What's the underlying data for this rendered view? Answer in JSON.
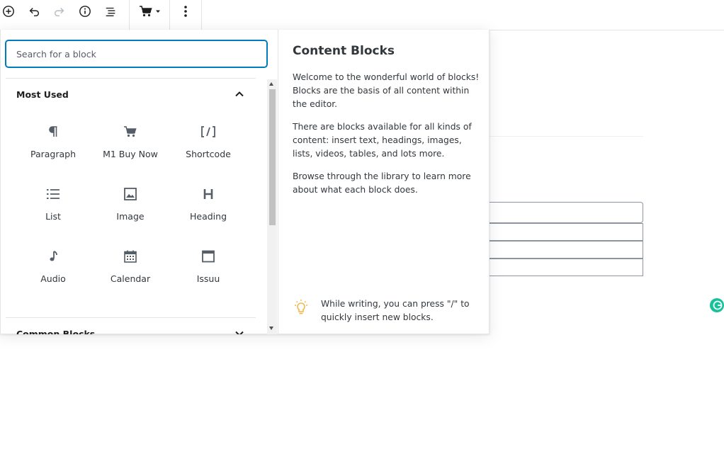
{
  "toolbar": {
    "buttons": [
      {
        "name": "add-block-button",
        "icon": "plus-circle-icon"
      },
      {
        "name": "undo-button",
        "icon": "undo-icon"
      },
      {
        "name": "redo-button",
        "icon": "redo-icon"
      },
      {
        "name": "info-button",
        "icon": "info-icon"
      },
      {
        "name": "outline-button",
        "icon": "list-outline-icon"
      },
      {
        "name": "cart-dropdown-button",
        "icon": "cart-icon"
      },
      {
        "name": "more-menu-button",
        "icon": "vertical-ellipsis-icon"
      }
    ]
  },
  "inserter": {
    "search_placeholder": "Search for a block",
    "most_used": {
      "title": "Most Used",
      "expanded": true,
      "blocks": [
        {
          "label": "Paragraph",
          "icon": "paragraph-icon"
        },
        {
          "label": "M1 Buy Now",
          "icon": "cart-icon"
        },
        {
          "label": "Shortcode",
          "icon": "shortcode-icon"
        },
        {
          "label": "List",
          "icon": "list-icon"
        },
        {
          "label": "Image",
          "icon": "image-icon"
        },
        {
          "label": "Heading",
          "icon": "heading-icon"
        },
        {
          "label": "Audio",
          "icon": "audio-icon"
        },
        {
          "label": "Calendar",
          "icon": "calendar-icon"
        },
        {
          "label": "Issuu",
          "icon": "browser-window-icon"
        }
      ]
    },
    "common_blocks": {
      "title": "Common Blocks",
      "expanded": false
    }
  },
  "preview": {
    "title": "Content Blocks",
    "paragraphs": [
      "Welcome to the wonderful world of blocks! Blocks are the basis of all content within the editor.",
      "There are blocks available for all kinds of content: insert text, headings, images, lists, videos, tables, and lots more.",
      "Browse through the library to learn more about what each block does."
    ],
    "tip": "While writing, you can press \"/\" to quickly insert new blocks."
  },
  "colors": {
    "accent": "#007cba",
    "tip_icon": "#f0b849",
    "grammarly": "#15c39a"
  }
}
